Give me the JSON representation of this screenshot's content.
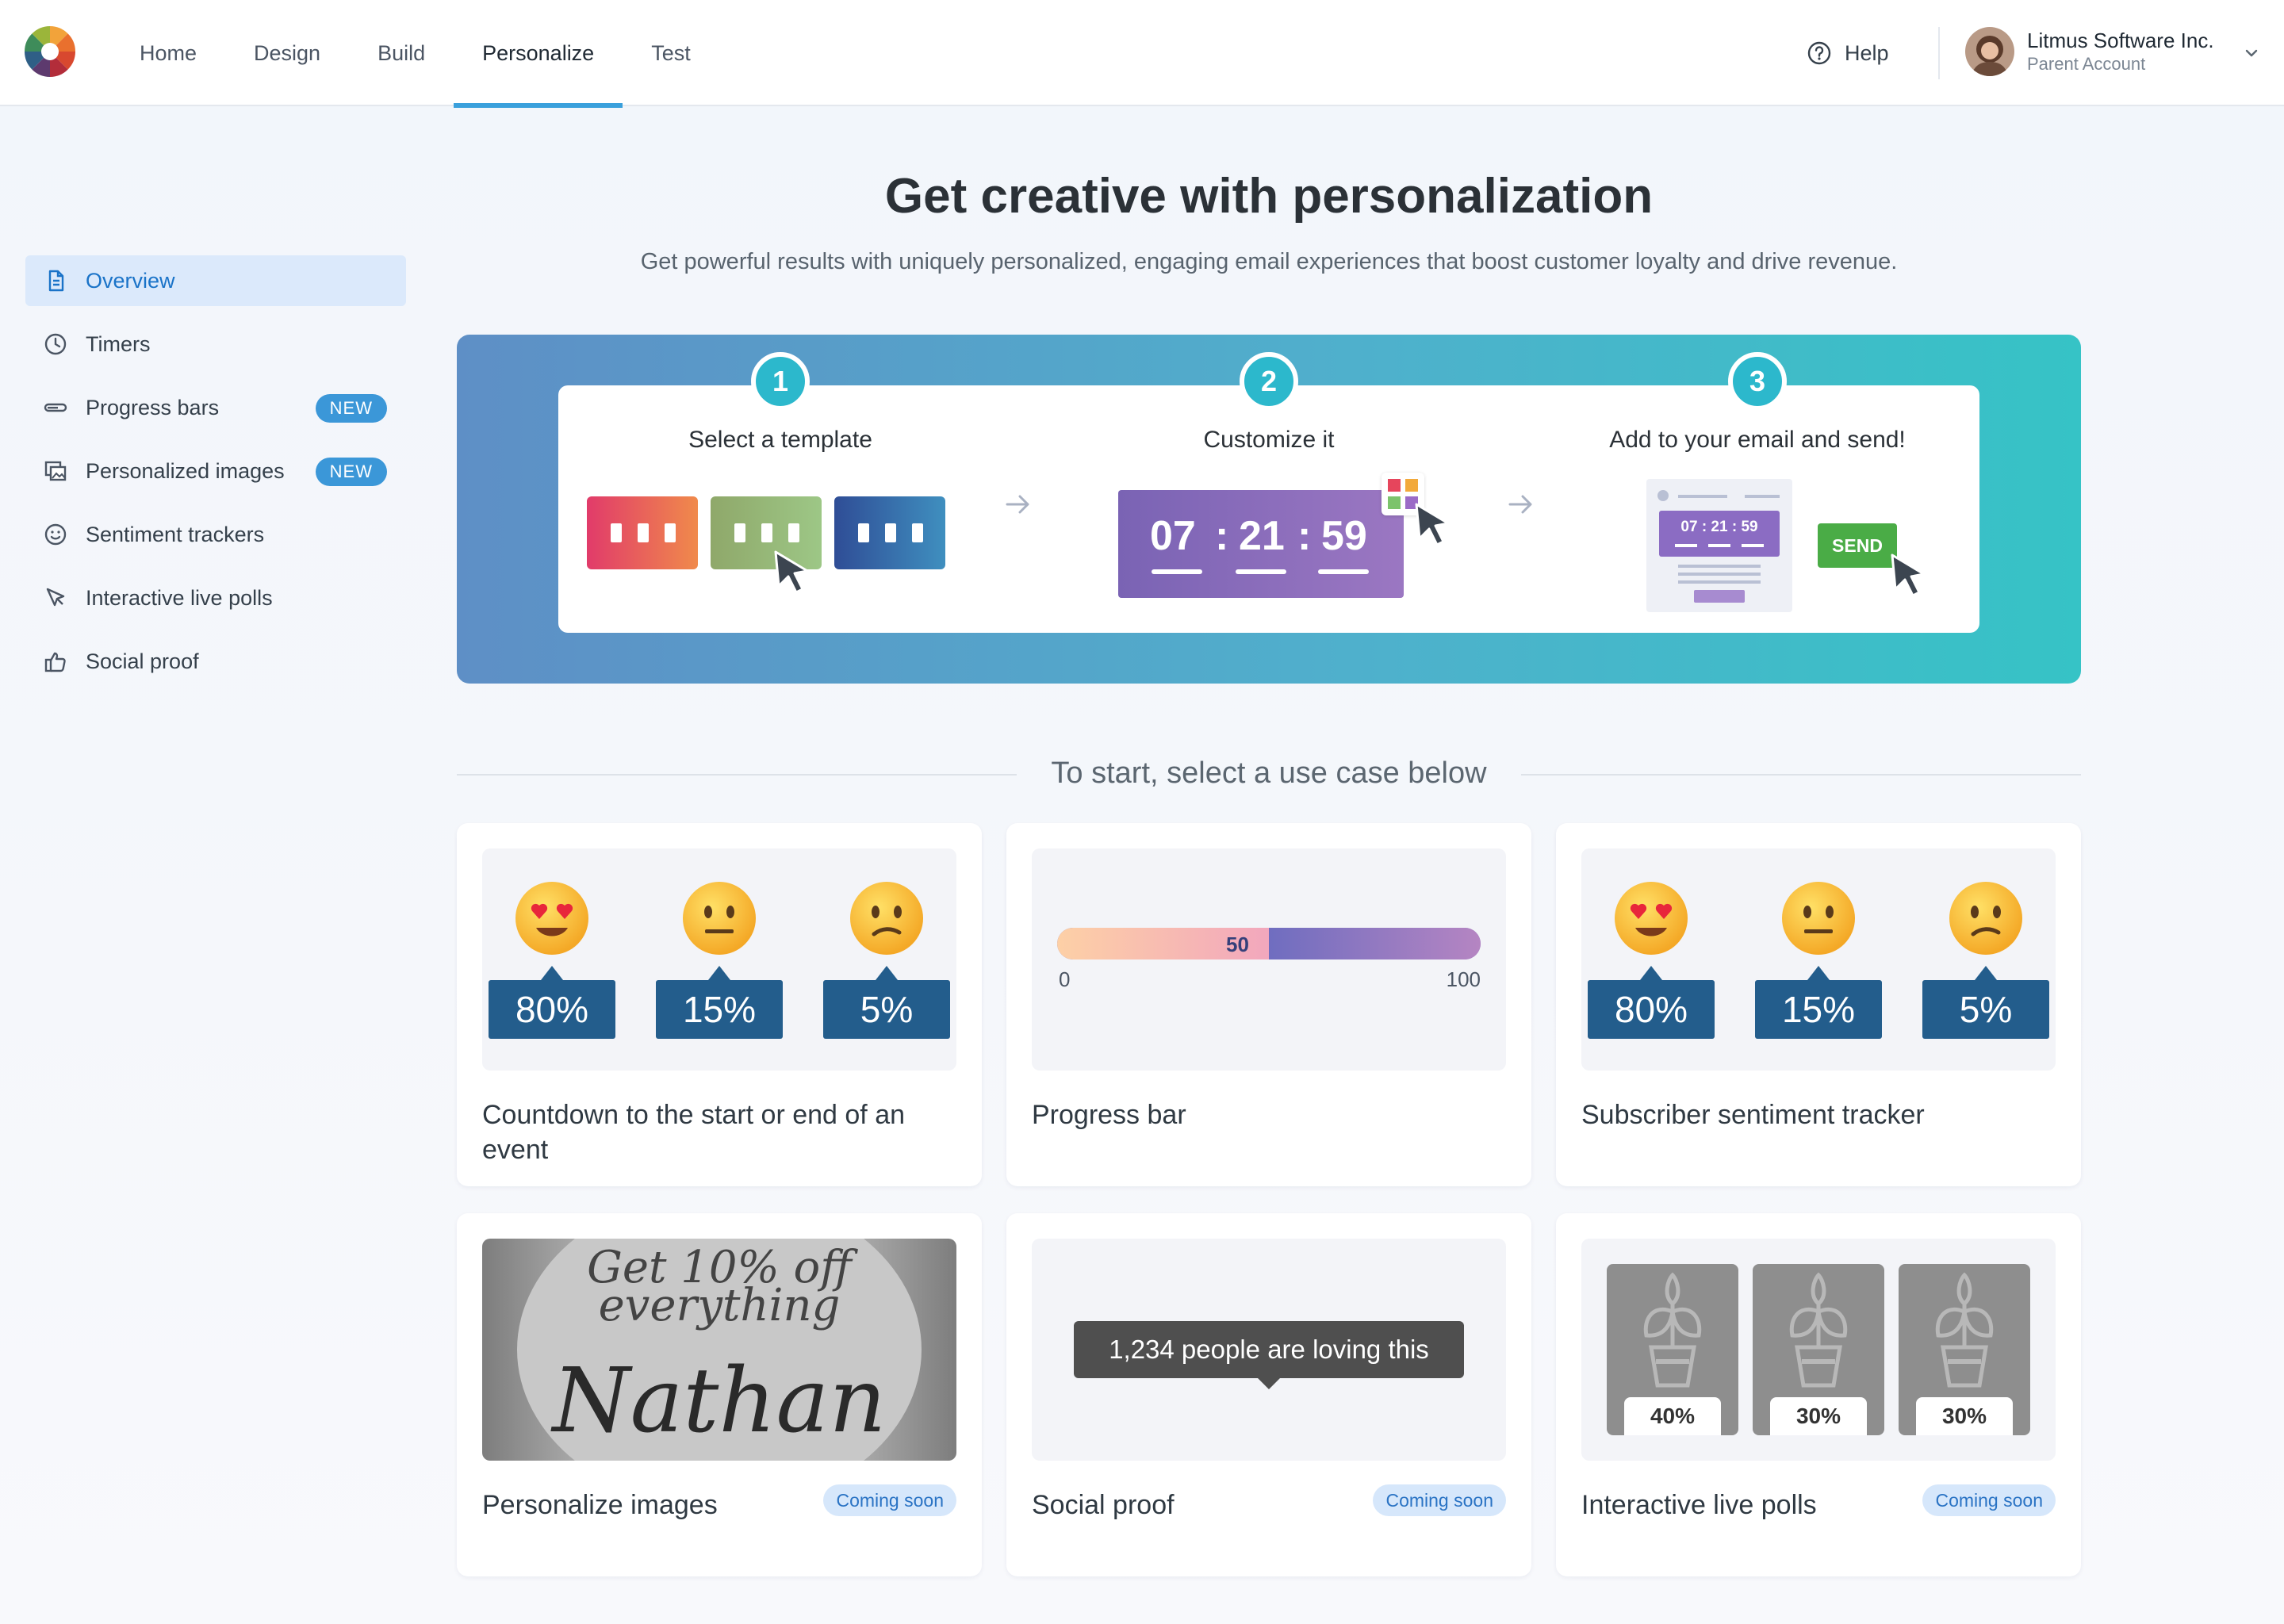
{
  "nav": {
    "items": [
      {
        "label": "Home"
      },
      {
        "label": "Design"
      },
      {
        "label": "Build"
      },
      {
        "label": "Personalize"
      },
      {
        "label": "Test"
      }
    ],
    "active": "Personalize",
    "help_label": "Help",
    "account_name": "Litmus Software Inc.",
    "account_sub": "Parent Account"
  },
  "sidebar": {
    "items": [
      {
        "label": "Overview",
        "icon": "document-icon",
        "active": true
      },
      {
        "label": "Timers",
        "icon": "clock-icon"
      },
      {
        "label": "Progress bars",
        "icon": "progress-bar-icon",
        "badge": "NEW"
      },
      {
        "label": "Personalized images",
        "icon": "images-icon",
        "badge": "NEW"
      },
      {
        "label": "Sentiment trackers",
        "icon": "smiley-icon"
      },
      {
        "label": "Interactive live polls",
        "icon": "cursor-icon"
      },
      {
        "label": "Social proof",
        "icon": "thumbs-up-icon"
      }
    ]
  },
  "hero": {
    "title": "Get creative with personalization",
    "subtitle": "Get powerful results with uniquely personalized, engaging email experiences that boost customer loyalty and drive revenue."
  },
  "steps": [
    {
      "num": "1",
      "label": "Select a template"
    },
    {
      "num": "2",
      "label": "Customize it",
      "timer": {
        "h": "07",
        "m": "21",
        "s": "59",
        "sep": ":"
      }
    },
    {
      "num": "3",
      "label": "Add to your email and send!",
      "mini_timer": "07 : 21 : 59",
      "send_label": "SEND"
    }
  ],
  "divider_text": "To start, select a use case below",
  "cards": [
    {
      "title": "Countdown to the start or end of an event",
      "sentiment": [
        "80%",
        "15%",
        "5%"
      ]
    },
    {
      "title": "Progress bar",
      "progress": {
        "value": 50,
        "min": "0",
        "max": "100",
        "label": "50"
      }
    },
    {
      "title": "Subscriber sentiment tracker",
      "sentiment": [
        "80%",
        "15%",
        "5%"
      ]
    },
    {
      "title": "Personalize images",
      "badge": "Coming soon",
      "image_text": {
        "line1": "Get 10% off",
        "line2": "everything",
        "name": "Nathan"
      }
    },
    {
      "title": "Social proof",
      "badge": "Coming soon",
      "tooltip": "1,234 people are loving this"
    },
    {
      "title": "Interactive live polls",
      "badge": "Coming soon",
      "polls": [
        "40%",
        "30%",
        "30%"
      ]
    }
  ],
  "colors": {
    "accent": "#3aa0dc",
    "badge": "#3b97d8",
    "pct_box": "#235d8c",
    "banner_start": "#5e8fc6",
    "banner_end": "#36c3c6"
  }
}
